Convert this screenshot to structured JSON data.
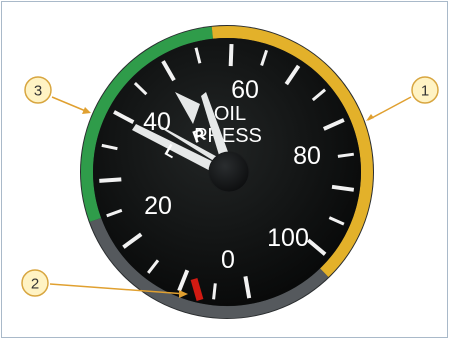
{
  "gauge": {
    "label_line1": "OIL",
    "label_line2": "PRESS",
    "needle_letters": [
      "L",
      "R"
    ],
    "scale_numbers": [
      "0",
      "20",
      "40",
      "60",
      "80",
      "100"
    ],
    "arcs": {
      "green": "#2f9c4a",
      "yellow": "#e3b12a",
      "gray": "#55595d",
      "red_line": "#d11a12"
    }
  },
  "callouts": [
    "1",
    "2",
    "3"
  ],
  "colors": {
    "frame_border": "#a9b9c9",
    "dial_face": "#0f1111",
    "callout_fill": "#fff3c4",
    "callout_stroke": "#d8a640",
    "leader_line": "#e0a030"
  }
}
